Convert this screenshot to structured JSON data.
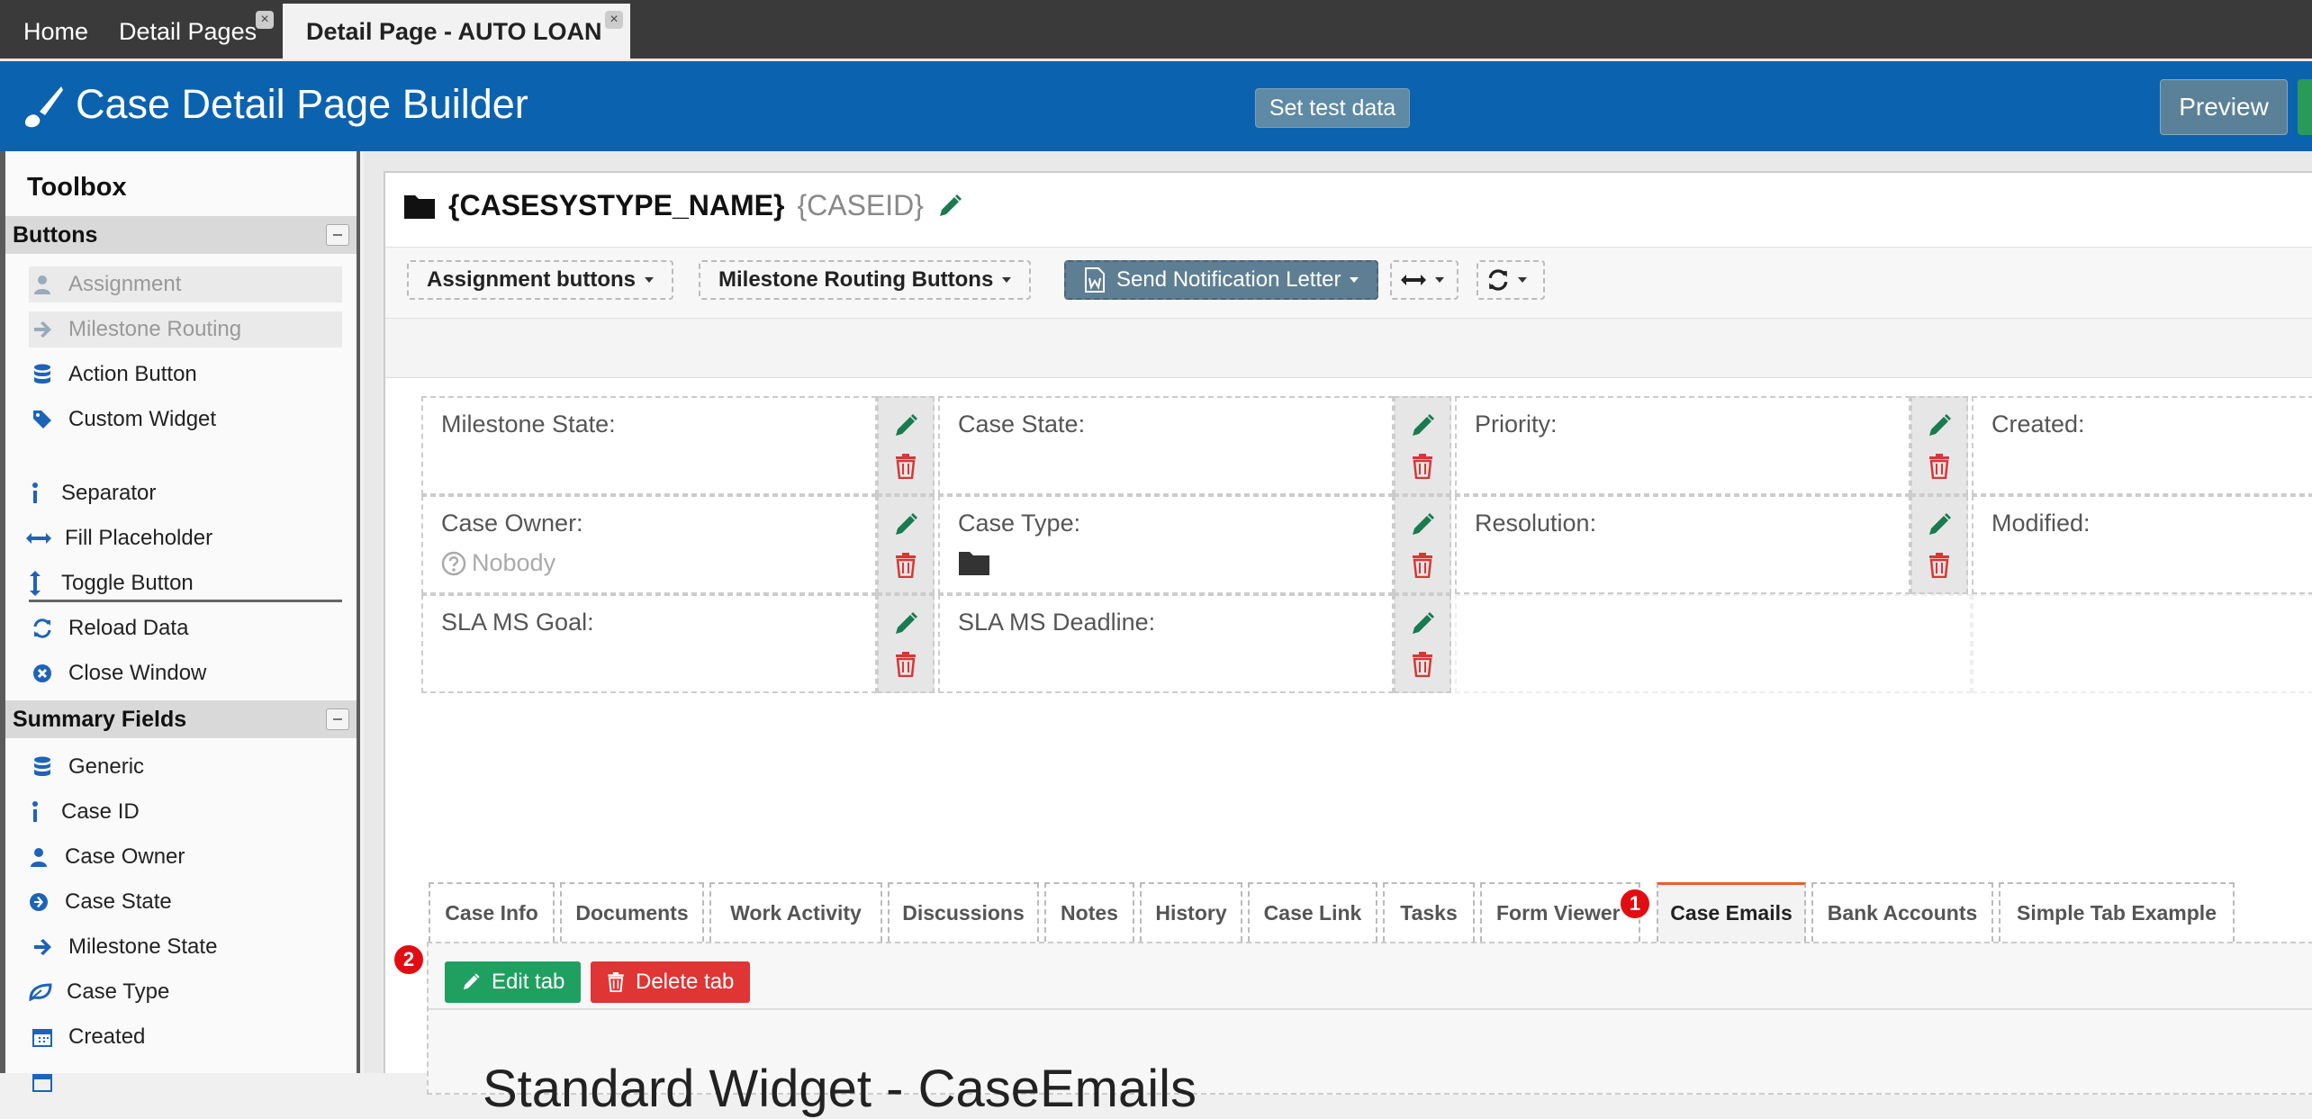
{
  "tabs": [
    {
      "label": "Home",
      "closable": false
    },
    {
      "label": "Detail Pages",
      "closable": true
    },
    {
      "label": "Detail Page - AUTO LOAN",
      "closable": true
    }
  ],
  "header": {
    "title": "Case Detail Page Builder",
    "set_test_data": "Set test data",
    "preview": "Preview"
  },
  "toolbox": {
    "title": "Toolbox",
    "sections": {
      "buttons": "Buttons",
      "summary": "Summary Fields"
    },
    "button_items": [
      {
        "label": "Assignment",
        "icon": "user-icon"
      },
      {
        "label": "Milestone Routing",
        "icon": "arrow-right-icon"
      },
      {
        "label": "Action Button",
        "icon": "database-icon"
      },
      {
        "label": "Custom Widget",
        "icon": "tag-icon"
      },
      {
        "label": "Separator",
        "icon": "vertical-dots-icon"
      },
      {
        "label": "Fill Placeholder",
        "icon": "horizontal-arrows-icon"
      },
      {
        "label": "Toggle Button",
        "icon": "vertical-arrows-icon"
      },
      {
        "label": "Reload Data",
        "icon": "refresh-icon"
      },
      {
        "label": "Close Window",
        "icon": "close-circle-icon"
      }
    ],
    "summary_items": [
      {
        "label": "Generic",
        "icon": "database-icon"
      },
      {
        "label": "Case ID",
        "icon": "info-icon"
      },
      {
        "label": "Case Owner",
        "icon": "user-icon"
      },
      {
        "label": "Case State",
        "icon": "arrow-circle-icon"
      },
      {
        "label": "Milestone State",
        "icon": "arrow-right-icon"
      },
      {
        "label": "Case Type",
        "icon": "leaf-icon"
      },
      {
        "label": "Created",
        "icon": "calendar-icon"
      }
    ]
  },
  "case": {
    "title": "{CASESYSTYPE_NAME}",
    "id": "{CASEID}"
  },
  "toolbar": {
    "assignment": "Assignment buttons",
    "milestone": "Milestone Routing Buttons",
    "notification": "Send Notification Letter"
  },
  "fields": {
    "milestone_state": "Milestone State:",
    "case_state": "Case State:",
    "priority": "Priority:",
    "created": "Created:",
    "case_owner": "Case Owner:",
    "case_owner_value": "Nobody",
    "case_type": "Case Type:",
    "resolution": "Resolution:",
    "modified": "Modified:",
    "sla_goal": "SLA MS Goal:",
    "sla_deadline": "SLA MS Deadline:"
  },
  "content_tabs": [
    "Case Info",
    "Documents",
    "Work Activity",
    "Discussions",
    "Notes",
    "History",
    "Case Link",
    "Tasks",
    "Form Viewer",
    "Case Emails",
    "Bank Accounts",
    "Simple Tab Example"
  ],
  "active_tab": "Case Emails",
  "tab_actions": {
    "edit": "Edit tab",
    "delete": "Delete tab"
  },
  "widget_title": "Standard Widget - CaseEmails",
  "badges": [
    "1",
    "2"
  ],
  "colors": {
    "header_blue": "#0b63b0",
    "edit_green": "#20a060",
    "delete_red": "#e03535",
    "active_tab_accent": "#e8602c"
  }
}
